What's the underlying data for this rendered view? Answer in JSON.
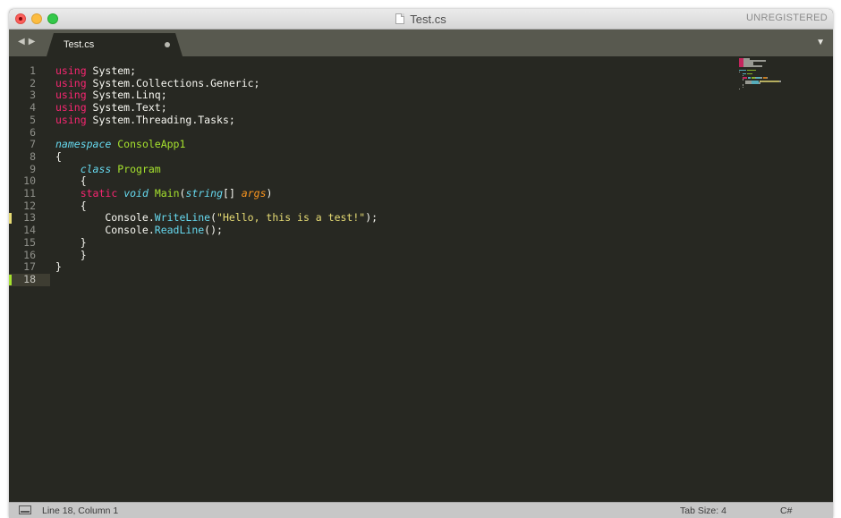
{
  "window": {
    "title": "Test.cs",
    "registration": "UNREGISTERED"
  },
  "tabs": [
    {
      "label": "Test.cs",
      "modified": true
    }
  ],
  "editor": {
    "line_numbers": [
      "1",
      "2",
      "3",
      "4",
      "5",
      "6",
      "7",
      "8",
      "9",
      "10",
      "11",
      "12",
      "13",
      "14",
      "15",
      "16",
      "17",
      "18"
    ],
    "active_line": 18,
    "lines": [
      [
        {
          "t": "using",
          "c": "kw"
        },
        {
          "t": " System;",
          "c": ""
        }
      ],
      [
        {
          "t": "using",
          "c": "kw"
        },
        {
          "t": " System.Collections.Generic;",
          "c": ""
        }
      ],
      [
        {
          "t": "using",
          "c": "kw"
        },
        {
          "t": " System.Linq;",
          "c": ""
        }
      ],
      [
        {
          "t": "using",
          "c": "kw"
        },
        {
          "t": " System.Text;",
          "c": ""
        }
      ],
      [
        {
          "t": "using",
          "c": "kw"
        },
        {
          "t": " System.Threading.Tasks;",
          "c": ""
        }
      ],
      [],
      [
        {
          "t": "namespace",
          "c": "st"
        },
        {
          "t": " ",
          "c": ""
        },
        {
          "t": "ConsoleApp1",
          "c": "cls"
        }
      ],
      [
        {
          "t": "{",
          "c": ""
        }
      ],
      [
        {
          "t": "    ",
          "c": ""
        },
        {
          "t": "class",
          "c": "st"
        },
        {
          "t": " ",
          "c": ""
        },
        {
          "t": "Program",
          "c": "cls"
        }
      ],
      [
        {
          "t": "    {",
          "c": ""
        }
      ],
      [
        {
          "t": "    ",
          "c": ""
        },
        {
          "t": "static",
          "c": "kw"
        },
        {
          "t": " ",
          "c": ""
        },
        {
          "t": "void",
          "c": "st"
        },
        {
          "t": " ",
          "c": ""
        },
        {
          "t": "Main",
          "c": "cls"
        },
        {
          "t": "(",
          "c": ""
        },
        {
          "t": "string",
          "c": "st"
        },
        {
          "t": "[] ",
          "c": ""
        },
        {
          "t": "args",
          "c": "arg"
        },
        {
          "t": ")",
          "c": ""
        }
      ],
      [
        {
          "t": "    {",
          "c": ""
        }
      ],
      [
        {
          "t": "        Console.",
          "c": ""
        },
        {
          "t": "WriteLine",
          "c": "fn"
        },
        {
          "t": "(",
          "c": ""
        },
        {
          "t": "\"Hello, this is a test!\"",
          "c": "str"
        },
        {
          "t": ");",
          "c": ""
        }
      ],
      [
        {
          "t": "        Console.",
          "c": ""
        },
        {
          "t": "ReadLine",
          "c": "fn"
        },
        {
          "t": "();",
          "c": ""
        }
      ],
      [
        {
          "t": "    }",
          "c": ""
        }
      ],
      [
        {
          "t": "    }",
          "c": ""
        }
      ],
      [
        {
          "t": "}",
          "c": ""
        }
      ],
      []
    ],
    "gutter_marks": [
      {
        "line": 13,
        "kind": "mod"
      },
      {
        "line": 18,
        "kind": "add"
      }
    ]
  },
  "status": {
    "position": "Line 18, Column 1",
    "tab_size": "Tab Size: 4",
    "syntax": "C#"
  },
  "icons": {
    "close": "close-dot",
    "nav_back": "◀",
    "nav_forward": "▶",
    "tab_menu": "▼"
  },
  "colors": {
    "background": "#272822",
    "keyword": "#f92672",
    "storage": "#66d9ef",
    "class_name": "#a6e22e",
    "string": "#e6db74",
    "argument": "#fd971f"
  }
}
